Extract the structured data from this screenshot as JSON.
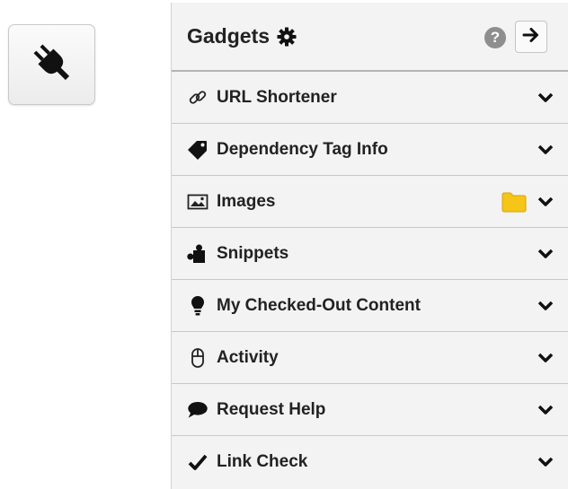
{
  "panel": {
    "title": "Gadgets",
    "help_label": "?",
    "gadgets": [
      {
        "label": "URL Shortener",
        "icon": "link-icon"
      },
      {
        "label": "Dependency Tag Info",
        "icon": "tag-icon"
      },
      {
        "label": "Images",
        "icon": "image-icon",
        "extra_icon": "folder-icon"
      },
      {
        "label": "Snippets",
        "icon": "puzzle-icon"
      },
      {
        "label": "My Checked-Out Content",
        "icon": "lightbulb-icon"
      },
      {
        "label": "Activity",
        "icon": "mouse-icon"
      },
      {
        "label": "Request Help",
        "icon": "speech-bubble-icon"
      },
      {
        "label": "Link Check",
        "icon": "checkmark-icon"
      }
    ]
  },
  "colors": {
    "panel_bg": "#f3f3f3",
    "folder": "#f5c518",
    "help_badge": "#8e8e8e"
  }
}
